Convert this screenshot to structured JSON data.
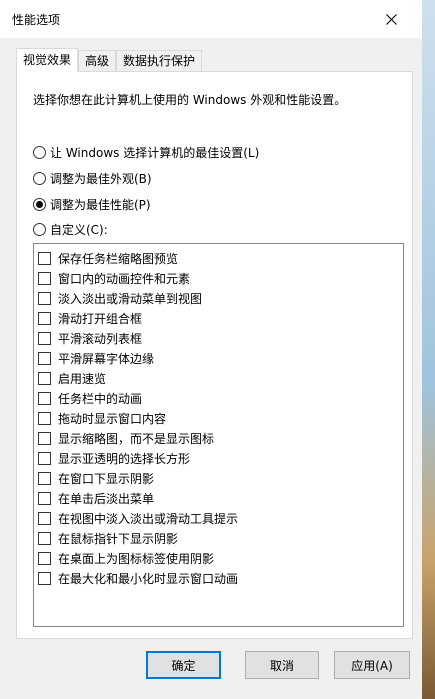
{
  "window": {
    "title": "性能选项"
  },
  "tabs": [
    {
      "label": "视觉效果"
    },
    {
      "label": "高级"
    },
    {
      "label": "数据执行保护"
    }
  ],
  "panel": {
    "intro": "选择你想在此计算机上使用的 Windows 外观和性能设置。",
    "radios": [
      {
        "label": "让 Windows 选择计算机的最佳设置(L)",
        "checked": false
      },
      {
        "label": "调整为最佳外观(B)",
        "checked": false
      },
      {
        "label": "调整为最佳性能(P)",
        "checked": true
      },
      {
        "label": "自定义(C):",
        "checked": false
      }
    ],
    "effects": [
      {
        "label": "保存任务栏缩略图预览",
        "checked": false
      },
      {
        "label": "窗口内的动画控件和元素",
        "checked": false
      },
      {
        "label": "淡入淡出或滑动菜单到视图",
        "checked": false
      },
      {
        "label": "滑动打开组合框",
        "checked": false
      },
      {
        "label": "平滑滚动列表框",
        "checked": false
      },
      {
        "label": "平滑屏幕字体边缘",
        "checked": false
      },
      {
        "label": "启用速览",
        "checked": false
      },
      {
        "label": "任务栏中的动画",
        "checked": false
      },
      {
        "label": "拖动时显示窗口内容",
        "checked": false
      },
      {
        "label": "显示缩略图，而不是显示图标",
        "checked": false
      },
      {
        "label": "显示亚透明的选择长方形",
        "checked": false
      },
      {
        "label": "在窗口下显示阴影",
        "checked": false
      },
      {
        "label": "在单击后淡出菜单",
        "checked": false
      },
      {
        "label": "在视图中淡入淡出或滑动工具提示",
        "checked": false
      },
      {
        "label": "在鼠标指针下显示阴影",
        "checked": false
      },
      {
        "label": "在桌面上为图标标签使用阴影",
        "checked": false
      },
      {
        "label": "在最大化和最小化时显示窗口动画",
        "checked": false
      }
    ]
  },
  "buttons": {
    "ok": "确定",
    "cancel": "取消",
    "apply": "应用(A)"
  },
  "colors": {
    "accent": "#0078d7",
    "dialog_bg": "#f0f0f0"
  }
}
